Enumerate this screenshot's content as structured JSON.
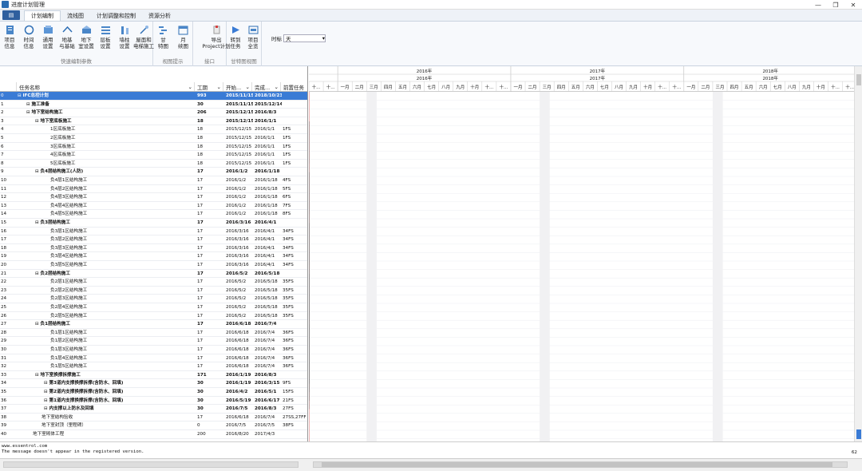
{
  "window": {
    "title": "进度计划管理",
    "controls": [
      "—",
      "❐",
      "✕"
    ]
  },
  "menu": {
    "file_label": "▤",
    "tabs": [
      "计划编制",
      "流线图",
      "计划调整和控制",
      "资源分析"
    ],
    "active_tab": 0
  },
  "ribbon": {
    "groups": [
      {
        "label": "快速编制参数",
        "buttons": [
          {
            "label": "项目\n信息",
            "icon": "project-info-icon"
          },
          {
            "label": "时间\n信息",
            "icon": "clock-icon"
          },
          {
            "label": "通用\n设置",
            "icon": "general-settings-icon"
          },
          {
            "label": "地基\n与基础",
            "icon": "foundation-icon"
          },
          {
            "label": "地下\n室设置",
            "icon": "basement-icon"
          },
          {
            "label": "层板\n设置",
            "icon": "floor-slab-icon"
          },
          {
            "label": "墙柱\n设置",
            "icon": "wall-column-icon"
          },
          {
            "label": "屋面和\n电梯施工",
            "icon": "roof-elevator-icon"
          }
        ]
      },
      {
        "label": "视图提示",
        "buttons": [
          {
            "label": "甘\n特图",
            "icon": "gantt-icon"
          },
          {
            "label": "月\n续图",
            "icon": "calendar-icon"
          }
        ]
      },
      {
        "label": "接口",
        "buttons": [
          {
            "label": "导出\nProject计划",
            "icon": "export-project-icon"
          }
        ]
      },
      {
        "label": "甘特图视图",
        "buttons": [
          {
            "label": "转到\n任务",
            "icon": "goto-task-icon"
          },
          {
            "label": "项目\n全览",
            "icon": "overview-icon"
          }
        ]
      }
    ],
    "timescale": {
      "label": "时标",
      "value": "天"
    }
  },
  "grid": {
    "columns": [
      "",
      "任务名称",
      "工期",
      "开始...",
      "完成...",
      "前置任务"
    ],
    "rows": [
      [
        "0",
        "IFC总控计划",
        "993",
        "2015/11/15",
        "2018/10/23",
        "",
        0,
        true
      ],
      [
        "1",
        "施工准备",
        "30",
        "2015/11/15",
        "2015/12/14",
        "",
        1,
        true
      ],
      [
        "2",
        "地下室结构施工",
        "206",
        "2015/12/15",
        "2016/8/3",
        "",
        1,
        true
      ],
      [
        "3",
        "地下室底板施工",
        "18",
        "2015/12/15",
        "2016/1/1",
        "",
        2,
        true
      ],
      [
        "4",
        "1区底板施工",
        "18",
        "2015/12/15",
        "2016/1/1",
        "1FS",
        3,
        false
      ],
      [
        "5",
        "2区底板施工",
        "18",
        "2015/12/15",
        "2016/1/1",
        "1FS",
        3,
        false
      ],
      [
        "6",
        "3区底板施工",
        "18",
        "2015/12/15",
        "2016/1/1",
        "1FS",
        3,
        false
      ],
      [
        "7",
        "4区底板施工",
        "18",
        "2015/12/15",
        "2016/1/1",
        "1FS",
        3,
        false
      ],
      [
        "8",
        "5区底板施工",
        "18",
        "2015/12/15",
        "2016/1/1",
        "1FS",
        3,
        false
      ],
      [
        "9",
        "负4层结构施工(人防)",
        "17",
        "2016/1/2",
        "2016/1/18",
        "",
        2,
        true
      ],
      [
        "10",
        "负4层1区结构施工",
        "17",
        "2016/1/2",
        "2016/1/18",
        "4FS",
        3,
        false
      ],
      [
        "11",
        "负4层2区结构施工",
        "17",
        "2016/1/2",
        "2016/1/18",
        "5FS",
        3,
        false
      ],
      [
        "12",
        "负4层3区结构施工",
        "17",
        "2016/1/2",
        "2016/1/18",
        "6FS",
        3,
        false
      ],
      [
        "13",
        "负4层4区结构施工",
        "17",
        "2016/1/2",
        "2016/1/18",
        "7FS",
        3,
        false
      ],
      [
        "14",
        "负4层5区结构施工",
        "17",
        "2016/1/2",
        "2016/1/18",
        "8FS",
        3,
        false
      ],
      [
        "15",
        "负3层结构施工",
        "17",
        "2016/3/16",
        "2016/4/1",
        "",
        2,
        true
      ],
      [
        "16",
        "负3层1区结构施工",
        "17",
        "2016/3/16",
        "2016/4/1",
        "34FS",
        3,
        false
      ],
      [
        "17",
        "负3层2区结构施工",
        "17",
        "2016/3/16",
        "2016/4/1",
        "34FS",
        3,
        false
      ],
      [
        "18",
        "负3层3区结构施工",
        "17",
        "2016/3/16",
        "2016/4/1",
        "34FS",
        3,
        false
      ],
      [
        "19",
        "负3层4区结构施工",
        "17",
        "2016/3/16",
        "2016/4/1",
        "34FS",
        3,
        false
      ],
      [
        "20",
        "负3层5区结构施工",
        "17",
        "2016/3/16",
        "2016/4/1",
        "34FS",
        3,
        false
      ],
      [
        "21",
        "负2层结构施工",
        "17",
        "2016/5/2",
        "2016/5/18",
        "",
        2,
        true
      ],
      [
        "22",
        "负2层1区结构施工",
        "17",
        "2016/5/2",
        "2016/5/18",
        "35FS",
        3,
        false
      ],
      [
        "23",
        "负2层2区结构施工",
        "17",
        "2016/5/2",
        "2016/5/18",
        "35FS",
        3,
        false
      ],
      [
        "24",
        "负2层3区结构施工",
        "17",
        "2016/5/2",
        "2016/5/18",
        "35FS",
        3,
        false
      ],
      [
        "25",
        "负2层4区结构施工",
        "17",
        "2016/5/2",
        "2016/5/18",
        "35FS",
        3,
        false
      ],
      [
        "26",
        "负2层5区结构施工",
        "17",
        "2016/5/2",
        "2016/5/18",
        "35FS",
        3,
        false
      ],
      [
        "27",
        "负1层结构施工",
        "17",
        "2016/6/18",
        "2016/7/4",
        "",
        2,
        true
      ],
      [
        "28",
        "负1层1区结构施工",
        "17",
        "2016/6/18",
        "2016/7/4",
        "36FS",
        3,
        false
      ],
      [
        "29",
        "负1层2区结构施工",
        "17",
        "2016/6/18",
        "2016/7/4",
        "36FS",
        3,
        false
      ],
      [
        "30",
        "负1层3区结构施工",
        "17",
        "2016/6/18",
        "2016/7/4",
        "36FS",
        3,
        false
      ],
      [
        "31",
        "负1层4区结构施工",
        "17",
        "2016/6/18",
        "2016/7/4",
        "36FS",
        3,
        false
      ],
      [
        "32",
        "负1层5区结构施工",
        "17",
        "2016/6/18",
        "2016/7/4",
        "36FS",
        3,
        false
      ],
      [
        "33",
        "地下室换撑拆撑施工",
        "171",
        "2016/1/19",
        "2016/8/3",
        "",
        2,
        true
      ],
      [
        "34",
        "第3道内支撑换撑拆撑(含防水、回填)",
        "30",
        "2016/1/19",
        "2016/3/15",
        "9FS",
        3,
        true
      ],
      [
        "35",
        "第2道内支撑换撑拆撑(含防水、回填)",
        "30",
        "2016/4/2",
        "2016/5/1",
        "15FS",
        3,
        true
      ],
      [
        "36",
        "第1道内支撑换撑拆撑(含防水、回填)",
        "30",
        "2016/5/19",
        "2016/6/17",
        "21FS",
        3,
        true
      ],
      [
        "37",
        "内支撑以上防水及回填",
        "30",
        "2016/7/5",
        "2016/8/3",
        "27FS",
        3,
        true
      ],
      [
        "38",
        "地下室结构验收",
        "17",
        "2016/6/18",
        "2016/7/4",
        "27SS,27FF",
        2,
        false
      ],
      [
        "39",
        "地下室封顶（里程碑）",
        "0",
        "2016/7/5",
        "2016/7/5",
        "38FS",
        2,
        false
      ],
      [
        "40",
        "地下室砌体工程",
        "200",
        "2016/8/20",
        "2017/4/3",
        "",
        1,
        false
      ]
    ]
  },
  "gantt": {
    "timeline_start": "2015/11/1",
    "years": [
      "2016年",
      "2017年",
      "2018年"
    ],
    "months": [
      "十...",
      "十...",
      "一月",
      "二月",
      "三月",
      "四月",
      "五月",
      "六月",
      "七月",
      "八月",
      "九月",
      "十月",
      "十...",
      "十...",
      "一月",
      "二月",
      "三月",
      "四月",
      "五月",
      "六月",
      "七月",
      "八月",
      "九月",
      "十月",
      "十...",
      "十...",
      "一月",
      "二月",
      "三月",
      "四月",
      "五月",
      "六月",
      "七月",
      "八月",
      "九月",
      "十月",
      "十...",
      "十..."
    ],
    "today": "2017/3/10"
  },
  "status": {
    "lines": [
      "www.essentrol.com",
      "The message doesn't appear in the registered version."
    ],
    "zoom": "62"
  },
  "colors": {
    "selected_row": "#3a7bd5",
    "task_bar": "#7b7be0",
    "summary_bar": "#000000",
    "today_line": "#d04040"
  }
}
